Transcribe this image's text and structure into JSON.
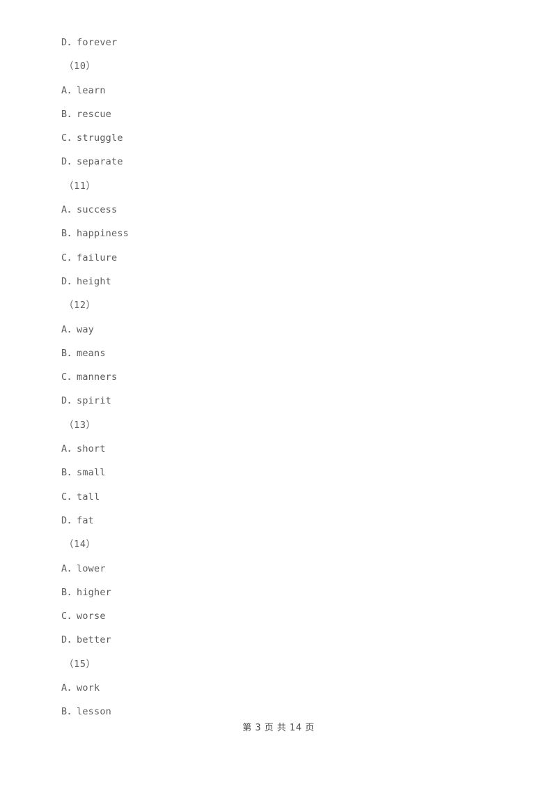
{
  "document": {
    "type": "exam-paper",
    "language": "zh-CN",
    "text_color": "#5d5d5d",
    "background_color": "#ffffff",
    "lines": [
      {
        "kind": "option",
        "text": "D．forever"
      },
      {
        "kind": "question",
        "text": "（10）"
      },
      {
        "kind": "option",
        "text": "A．learn"
      },
      {
        "kind": "option",
        "text": "B．rescue"
      },
      {
        "kind": "option",
        "text": "C．struggle"
      },
      {
        "kind": "option",
        "text": "D．separate"
      },
      {
        "kind": "question",
        "text": "（11）"
      },
      {
        "kind": "option",
        "text": "A．success"
      },
      {
        "kind": "option",
        "text": "B．happiness"
      },
      {
        "kind": "option",
        "text": "C．failure"
      },
      {
        "kind": "option",
        "text": "D．height"
      },
      {
        "kind": "question",
        "text": "（12）"
      },
      {
        "kind": "option",
        "text": "A．way"
      },
      {
        "kind": "option",
        "text": "B．means"
      },
      {
        "kind": "option",
        "text": "C．manners"
      },
      {
        "kind": "option",
        "text": "D．spirit"
      },
      {
        "kind": "question",
        "text": "（13）"
      },
      {
        "kind": "option",
        "text": "A．short"
      },
      {
        "kind": "option",
        "text": "B．small"
      },
      {
        "kind": "option",
        "text": "C．tall"
      },
      {
        "kind": "option",
        "text": "D．fat"
      },
      {
        "kind": "question",
        "text": "（14）"
      },
      {
        "kind": "option",
        "text": "A．lower"
      },
      {
        "kind": "option",
        "text": "B．higher"
      },
      {
        "kind": "option",
        "text": "C．worse"
      },
      {
        "kind": "option",
        "text": "D．better"
      },
      {
        "kind": "question",
        "text": "（15）"
      },
      {
        "kind": "option",
        "text": "A．work"
      },
      {
        "kind": "option",
        "text": "B．lesson"
      }
    ]
  },
  "footer": {
    "text": "第 3 页 共 14 页",
    "current_page": "3",
    "total_pages": "14"
  }
}
